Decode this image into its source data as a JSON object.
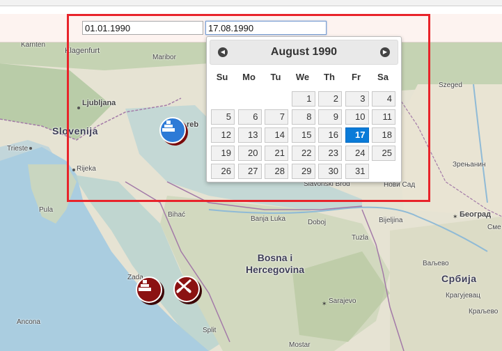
{
  "filters": {
    "start_date": "01.01.1990",
    "end_date": "17.08.1990"
  },
  "datepicker": {
    "title": "August 1990",
    "prev_icon": "chevron-left-icon",
    "next_icon": "chevron-right-icon",
    "weekdays": [
      "Su",
      "Mo",
      "Tu",
      "We",
      "Th",
      "Fr",
      "Sa"
    ],
    "weeks": [
      [
        "",
        "",
        "",
        "1",
        "2",
        "3",
        "4"
      ],
      [
        "5",
        "6",
        "7",
        "8",
        "9",
        "10",
        "11"
      ],
      [
        "12",
        "13",
        "14",
        "15",
        "16",
        "17",
        "18"
      ],
      [
        "19",
        "20",
        "21",
        "22",
        "23",
        "24",
        "25"
      ],
      [
        "26",
        "27",
        "28",
        "29",
        "30",
        "31",
        ""
      ]
    ],
    "selected_day": "17",
    "selected_color": "#0a7bd8"
  },
  "map": {
    "labels": {
      "karnten": "Kärnten",
      "klagenfurt": "Klagenfurt",
      "maribor": "Maribor",
      "ljubljana": "Ljubljana",
      "slovenija": "Slovenija",
      "trieste": "Trieste",
      "rijeka": "Rijeka",
      "pula": "Pula",
      "zagreb_part": "reb",
      "szeged": "Szeged",
      "zrenjanin": "Зрењанин",
      "novi_sad": "Нови Сад",
      "slavonski_brod": "Slavonski Brod",
      "beograd": "Београд",
      "srbija": "Србија",
      "bihac": "Bihać",
      "banja_luka": "Banja Luka",
      "doboj": "Doboj",
      "bijeljina": "Bijeljina",
      "bosna": "Bosna i",
      "hercegovina": "Hercegovina",
      "tuzla": "Tuzla",
      "sarajevo": "Sarajevo",
      "zadar": "Zada",
      "split": "Split",
      "ancona": "Ancona",
      "mostar": "Mostar",
      "valjevo": "Ваљево",
      "kraljevo": "Краљево",
      "kragujevac": "Крагујевац",
      "sme": "Сме"
    },
    "markers": [
      {
        "name": "monument-icon",
        "color": "#2d7ad6"
      },
      {
        "name": "monument-icon",
        "color": "#8b1212"
      },
      {
        "name": "crossed-rifles-icon",
        "color": "#8b1212"
      }
    ]
  }
}
